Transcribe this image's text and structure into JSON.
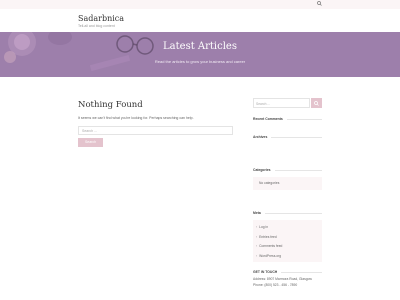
{
  "topbar": {
    "search_icon": "search-icon"
  },
  "site": {
    "title": "Sadarbnica",
    "tagline": "Tell-all and blog content"
  },
  "hero": {
    "title": "Latest Articles",
    "subtitle": "Read the articles to grow your business and career"
  },
  "main": {
    "heading": "Nothing Found",
    "message": "It seems we can't find what you're looking for. Perhaps searching can help.",
    "search_placeholder": "Search ...",
    "search_button": "Search"
  },
  "sidebar": {
    "search_placeholder": "Search ...",
    "recent_comments_title": "Recent Comments",
    "archives_title": "Archives",
    "categories_title": "Categories",
    "no_categories": "No categories",
    "meta_title": "Meta",
    "meta_items": [
      "Log in",
      "Entries feed",
      "Comments feed",
      "WordPress.org"
    ],
    "contact_title": "GET IN TOUCH",
    "contact_address": "Address: 8907 Marmora Road, Glasgow",
    "contact_phone": "Phone: (800) 523 - 456 - 7890"
  },
  "colors": {
    "accent": "#e4c3cd",
    "hero": "#9d7fab",
    "light": "#fbf5f6"
  }
}
